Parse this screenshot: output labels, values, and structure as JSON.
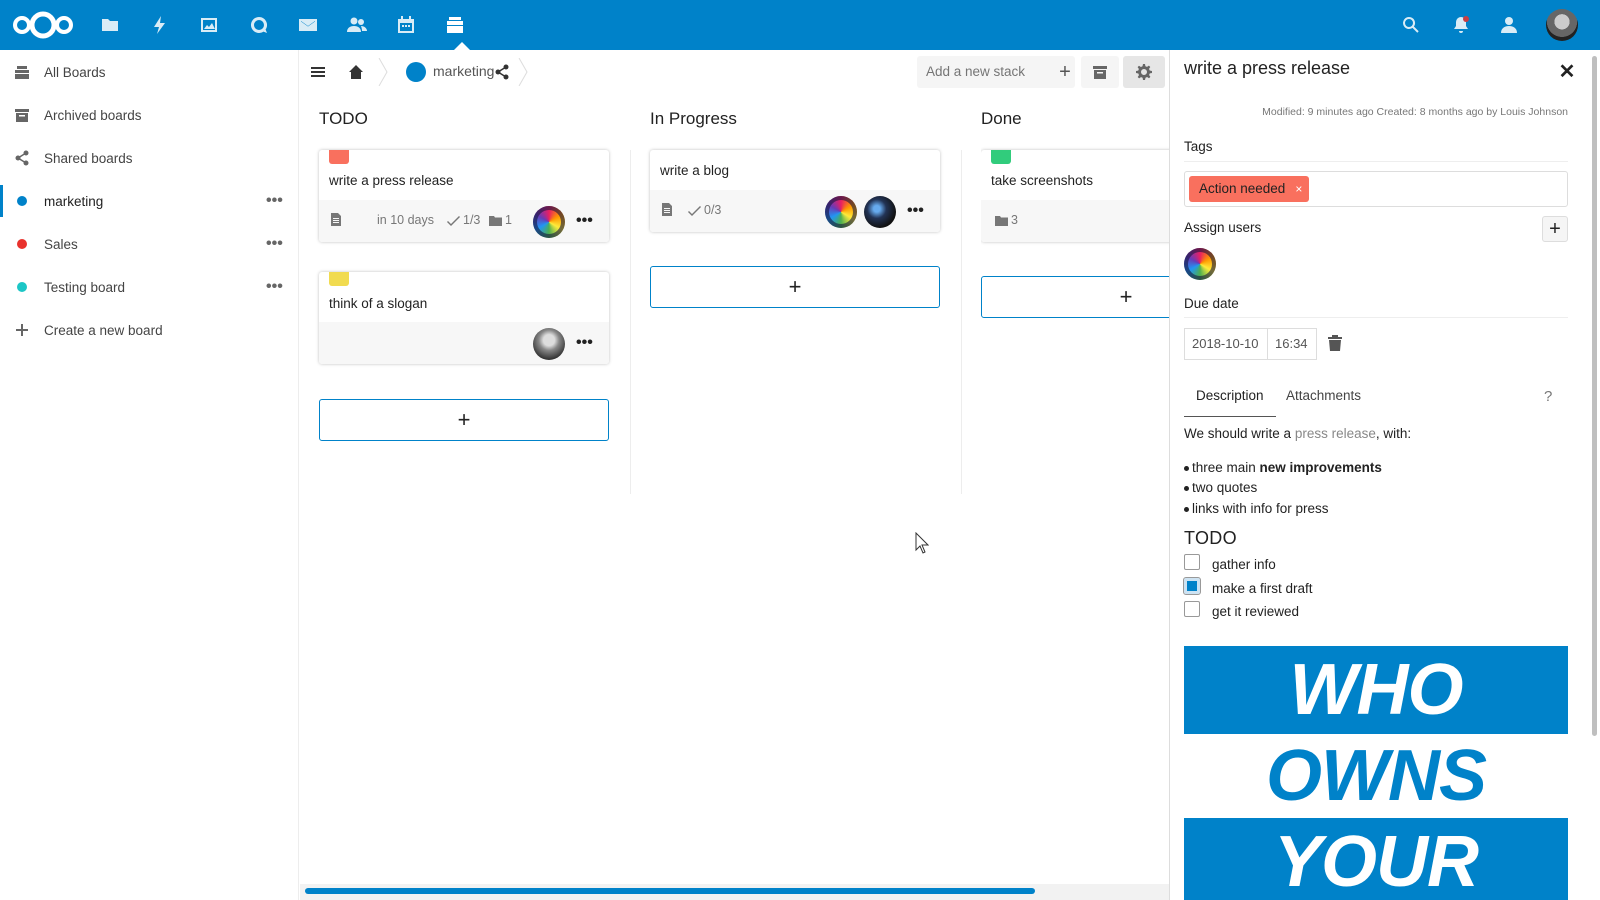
{
  "header": {
    "apps": [
      "files-icon",
      "activity-icon",
      "gallery-icon",
      "talk-icon",
      "mail-icon",
      "contacts-icon",
      "calendar-icon",
      "deck-icon"
    ],
    "right": [
      "search-icon",
      "notifications-icon",
      "contacts-menu-icon"
    ]
  },
  "nav": {
    "items": [
      {
        "label": "All Boards",
        "icon": "all-boards-icon"
      },
      {
        "label": "Archived boards",
        "icon": "archive-icon"
      },
      {
        "label": "Shared boards",
        "icon": "share-icon"
      },
      {
        "label": "marketing",
        "color": "#0082c9",
        "more": "•••"
      },
      {
        "label": "Sales",
        "color": "#e9322d",
        "more": "•••"
      },
      {
        "label": "Testing board",
        "color": "#1cc6c6",
        "more": "•••"
      },
      {
        "label": "Create a new board",
        "icon": "plus-icon"
      }
    ]
  },
  "toolbar": {
    "board_name": "marketing",
    "stack_placeholder": "Add a new stack",
    "stack_add": "+"
  },
  "stacks": [
    {
      "title": "TODO",
      "cards": [
        {
          "title": "write a press release",
          "label_color": "#f9705e",
          "due": "in 10 days",
          "checklist": "1/3",
          "attachments": "1",
          "more": "•••"
        },
        {
          "title": "think of a slogan",
          "label_color": "#f1db50",
          "more": "•••"
        }
      ],
      "add": "+"
    },
    {
      "title": "In Progress",
      "cards": [
        {
          "title": "write a blog",
          "checklist": "0/3",
          "more": "•••"
        }
      ],
      "add": "+"
    },
    {
      "title": "Done",
      "cards": [
        {
          "title": "take screenshots",
          "label_color": "#31cc7c",
          "attachments": "3"
        }
      ],
      "add": "+"
    }
  ],
  "sidebar": {
    "title": "write a press release",
    "close": "✕",
    "meta": "Modified: 9 minutes ago Created: 8 months ago by Louis Johnson",
    "tags_label": "Tags",
    "tag": "Action needed",
    "tag_remove": "×",
    "assign_label": "Assign users",
    "assign_add": "+",
    "due_label": "Due date",
    "due_date": "2018-10-10",
    "due_time": "16:34",
    "tabs": [
      "Description",
      "Attachments"
    ],
    "help": "?",
    "desc_pre": "We should write a ",
    "desc_link": "press release",
    "desc_post": ", with:",
    "bullets": [
      {
        "pre": "three main ",
        "bold": "new improvements"
      },
      {
        "pre": "two quotes",
        "bold": ""
      },
      {
        "pre": "links with info for press",
        "bold": ""
      }
    ],
    "todo_heading": "TODO",
    "checklist": [
      {
        "label": "gather info",
        "checked": false
      },
      {
        "label": "make a first draft",
        "checked": true
      },
      {
        "label": "get it reviewed",
        "checked": false
      }
    ],
    "poster_words": [
      "WHO",
      "OWNS",
      "YOUR"
    ]
  }
}
